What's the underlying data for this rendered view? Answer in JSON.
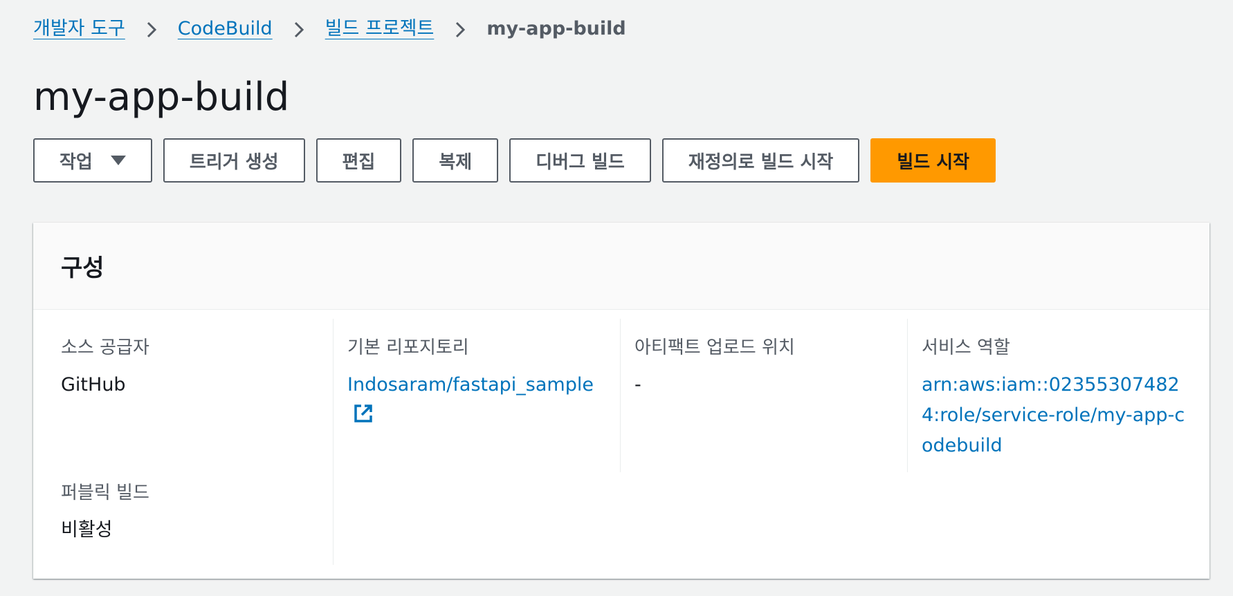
{
  "breadcrumb": {
    "items": [
      "개발자 도구",
      "CodeBuild",
      "빌드 프로젝트"
    ],
    "current": "my-app-build"
  },
  "page": {
    "title": "my-app-build"
  },
  "actions": {
    "actions_menu": "작업",
    "create_trigger": "트리거 생성",
    "edit": "편집",
    "clone": "복제",
    "debug_build": "디버그 빌드",
    "start_build_with_overrides": "재정의로 빌드 시작",
    "start_build": "빌드 시작"
  },
  "configuration": {
    "title": "구성",
    "source_provider": {
      "label": "소스 공급자",
      "value": "GitHub"
    },
    "primary_repository": {
      "label": "기본 리포지토리",
      "value": "Indosaram/fastapi_sample"
    },
    "artifacts_upload_location": {
      "label": "아티팩트 업로드 위치",
      "value": "-"
    },
    "service_role": {
      "label": "서비스 역할",
      "value": "arn:aws:iam::023553074824:role/service-role/my-app-codebuild"
    },
    "public_build": {
      "label": "퍼블릭 빌드",
      "value": "비활성"
    }
  },
  "colors": {
    "link": "#0073bb",
    "primary_button": "#ff9900",
    "background": "#f2f3f3"
  },
  "icons": {
    "breadcrumb_separator": "chevron-right-icon",
    "actions_dropdown": "caret-down-icon",
    "repository_link": "external-link-icon"
  }
}
